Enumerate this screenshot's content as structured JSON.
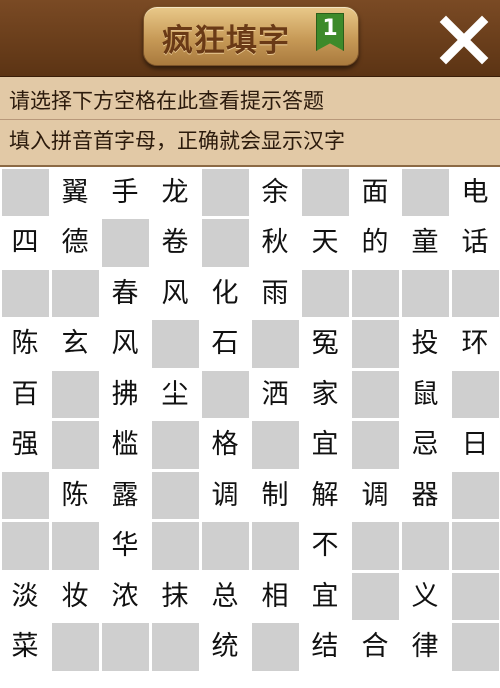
{
  "header": {
    "title": "疯狂填字",
    "level": "1",
    "close_icon": "close-icon"
  },
  "hints": {
    "line1": "请选择下方空格在此查看提示答题",
    "line2": "填入拼音首字母，正确就会显示汉字"
  },
  "colors": {
    "header_bg": "#6b3c1a",
    "hint_bg": "#e2c9a6",
    "block_cell": "#cfcfcf",
    "letter_cell": "#ffffff",
    "badge_green": "#3d8a2a"
  },
  "grid": {
    "rows": 10,
    "cols": 10,
    "cells": [
      [
        "",
        "翼",
        "手",
        "龙",
        "",
        "余",
        "",
        "面",
        "",
        "电"
      ],
      [
        "四",
        "德",
        "",
        "卷",
        "",
        "秋",
        "天",
        "的",
        "童",
        "话"
      ],
      [
        "",
        "",
        "春",
        "风",
        "化",
        "雨",
        "",
        "",
        "",
        ""
      ],
      [
        "陈",
        "玄",
        "风",
        "",
        "石",
        "",
        "冤",
        "",
        "投",
        "环"
      ],
      [
        "百",
        "",
        "拂",
        "尘",
        "",
        "洒",
        "家",
        "",
        "鼠",
        ""
      ],
      [
        "强",
        "",
        "槛",
        "",
        "格",
        "",
        "宜",
        "",
        "忌",
        "日"
      ],
      [
        "",
        "陈",
        "露",
        "",
        "调",
        "制",
        "解",
        "调",
        "器",
        ""
      ],
      [
        "",
        "",
        "华",
        "",
        "",
        "",
        "不",
        "",
        "",
        ""
      ],
      [
        "淡",
        "妆",
        "浓",
        "抹",
        "总",
        "相",
        "宜",
        "",
        "义",
        ""
      ],
      [
        "菜",
        "",
        "",
        "",
        "统",
        "",
        "结",
        "合",
        "律",
        ""
      ]
    ]
  }
}
